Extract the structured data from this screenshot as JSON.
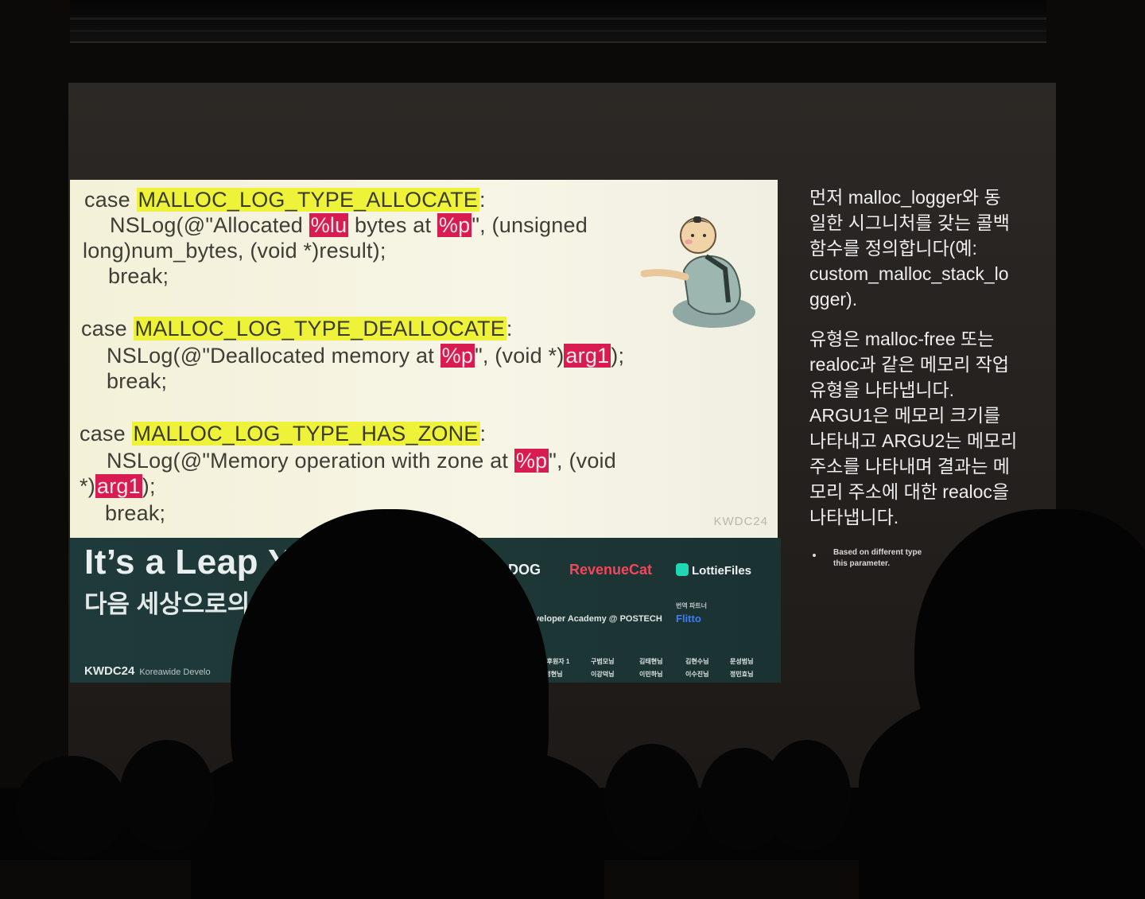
{
  "code": {
    "lines": [
      {
        "parts": [
          {
            "t": "case ",
            "h": ""
          },
          {
            "t": "MALLOC_LOG_TYPE_ALLOCATE",
            "h": "y"
          },
          {
            "t": ":",
            "h": ""
          }
        ]
      },
      {
        "parts": [
          {
            "t": "NSLog(@\"Allocated ",
            "h": ""
          },
          {
            "t": "%lu",
            "h": "r"
          },
          {
            "t": " bytes at ",
            "h": ""
          },
          {
            "t": "%p",
            "h": "r"
          },
          {
            "t": "\", (unsigned",
            "h": ""
          }
        ]
      },
      {
        "parts": [
          {
            "t": "long)num_bytes, (void *)result);",
            "h": ""
          }
        ]
      },
      {
        "parts": [
          {
            "t": "break;",
            "h": ""
          }
        ]
      },
      {
        "parts": [
          {
            "t": "case ",
            "h": ""
          },
          {
            "t": "MALLOC_LOG_TYPE_DEALLOCATE",
            "h": "y"
          },
          {
            "t": ":",
            "h": ""
          }
        ]
      },
      {
        "parts": [
          {
            "t": "NSLog(@\"Deallocated memory at ",
            "h": ""
          },
          {
            "t": "%p",
            "h": "r"
          },
          {
            "t": "\", (void *)",
            "h": ""
          },
          {
            "t": "arg1",
            "h": "r"
          },
          {
            "t": ");",
            "h": ""
          }
        ]
      },
      {
        "parts": [
          {
            "t": "break;",
            "h": ""
          }
        ]
      },
      {
        "parts": [
          {
            "t": "case ",
            "h": ""
          },
          {
            "t": "MALLOC_LOG_TYPE_HAS_ZONE",
            "h": "y"
          },
          {
            "t": ":",
            "h": ""
          }
        ]
      },
      {
        "parts": [
          {
            "t": "NSLog(@\"Memory operation with zone at ",
            "h": ""
          },
          {
            "t": "%p",
            "h": "r"
          },
          {
            "t": "\", (void",
            "h": ""
          }
        ]
      },
      {
        "parts": [
          {
            "t": "*)",
            "h": ""
          },
          {
            "t": "arg1",
            "h": "r"
          },
          {
            "t": ");",
            "h": ""
          }
        ]
      },
      {
        "parts": [
          {
            "t": "break;",
            "h": ""
          }
        ]
      }
    ],
    "watermark": "KWDC24"
  },
  "banner": {
    "title": "It’s a Leap Y",
    "subtitle": "다음 세상으로의",
    "logo_datadog": "ADOG",
    "logo_revenuecat": "RevenueCat",
    "logo_lottiefiles": "LottieFiles",
    "academy": "Developer Academy @ POSTECH",
    "translate_label": "번역 파트너",
    "flitto": "Flitto",
    "footer_brand": "KWDC24",
    "footer_text": "Koreawide Develo",
    "credits": [
      "회 후원자 1",
      "구범모님",
      "김태현님",
      "김현수님",
      "문성범님",
      "한정현님",
      "이강덕님",
      "이민하님",
      "이수진님",
      "정민효님"
    ]
  },
  "notes": {
    "para1": "먼저 malloc_logger와 동\n일한 시그니처를 갖는 콜백\n함수를 정의합니다(예:\ncustom_malloc_stack_lo\ngger).",
    "para2": "유형은 malloc-free 또는\nrealoc과 같은 메모리 작업\n유형을 나타냅니다.\nARGU1은 메모리 크기를\n나타내고 ARGU2는 메모리\n주소를 나타내며 결과는 메\n모리 주소에 대한 realoc을\n나타냅니다.",
    "footnote_line1": "Based on different type",
    "footnote_line2": "this parameter."
  },
  "colors": {
    "highlight_yellow": "#eef33a",
    "highlight_red": "#d81c52",
    "banner_green": "#1f3a3a",
    "revenuecat_red": "#f2475b",
    "flitto_blue": "#3d7bff"
  }
}
